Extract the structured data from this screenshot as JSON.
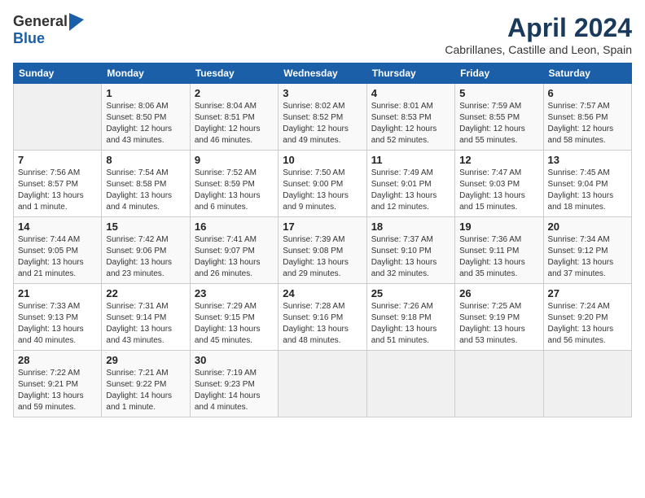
{
  "header": {
    "logo_general": "General",
    "logo_blue": "Blue",
    "month_year": "April 2024",
    "location": "Cabrillanes, Castille and Leon, Spain"
  },
  "calendar": {
    "days_of_week": [
      "Sunday",
      "Monday",
      "Tuesday",
      "Wednesday",
      "Thursday",
      "Friday",
      "Saturday"
    ],
    "weeks": [
      [
        {
          "day": "",
          "info": ""
        },
        {
          "day": "1",
          "info": "Sunrise: 8:06 AM\nSunset: 8:50 PM\nDaylight: 12 hours\nand 43 minutes."
        },
        {
          "day": "2",
          "info": "Sunrise: 8:04 AM\nSunset: 8:51 PM\nDaylight: 12 hours\nand 46 minutes."
        },
        {
          "day": "3",
          "info": "Sunrise: 8:02 AM\nSunset: 8:52 PM\nDaylight: 12 hours\nand 49 minutes."
        },
        {
          "day": "4",
          "info": "Sunrise: 8:01 AM\nSunset: 8:53 PM\nDaylight: 12 hours\nand 52 minutes."
        },
        {
          "day": "5",
          "info": "Sunrise: 7:59 AM\nSunset: 8:55 PM\nDaylight: 12 hours\nand 55 minutes."
        },
        {
          "day": "6",
          "info": "Sunrise: 7:57 AM\nSunset: 8:56 PM\nDaylight: 12 hours\nand 58 minutes."
        }
      ],
      [
        {
          "day": "7",
          "info": "Sunrise: 7:56 AM\nSunset: 8:57 PM\nDaylight: 13 hours\nand 1 minute."
        },
        {
          "day": "8",
          "info": "Sunrise: 7:54 AM\nSunset: 8:58 PM\nDaylight: 13 hours\nand 4 minutes."
        },
        {
          "day": "9",
          "info": "Sunrise: 7:52 AM\nSunset: 8:59 PM\nDaylight: 13 hours\nand 6 minutes."
        },
        {
          "day": "10",
          "info": "Sunrise: 7:50 AM\nSunset: 9:00 PM\nDaylight: 13 hours\nand 9 minutes."
        },
        {
          "day": "11",
          "info": "Sunrise: 7:49 AM\nSunset: 9:01 PM\nDaylight: 13 hours\nand 12 minutes."
        },
        {
          "day": "12",
          "info": "Sunrise: 7:47 AM\nSunset: 9:03 PM\nDaylight: 13 hours\nand 15 minutes."
        },
        {
          "day": "13",
          "info": "Sunrise: 7:45 AM\nSunset: 9:04 PM\nDaylight: 13 hours\nand 18 minutes."
        }
      ],
      [
        {
          "day": "14",
          "info": "Sunrise: 7:44 AM\nSunset: 9:05 PM\nDaylight: 13 hours\nand 21 minutes."
        },
        {
          "day": "15",
          "info": "Sunrise: 7:42 AM\nSunset: 9:06 PM\nDaylight: 13 hours\nand 23 minutes."
        },
        {
          "day": "16",
          "info": "Sunrise: 7:41 AM\nSunset: 9:07 PM\nDaylight: 13 hours\nand 26 minutes."
        },
        {
          "day": "17",
          "info": "Sunrise: 7:39 AM\nSunset: 9:08 PM\nDaylight: 13 hours\nand 29 minutes."
        },
        {
          "day": "18",
          "info": "Sunrise: 7:37 AM\nSunset: 9:10 PM\nDaylight: 13 hours\nand 32 minutes."
        },
        {
          "day": "19",
          "info": "Sunrise: 7:36 AM\nSunset: 9:11 PM\nDaylight: 13 hours\nand 35 minutes."
        },
        {
          "day": "20",
          "info": "Sunrise: 7:34 AM\nSunset: 9:12 PM\nDaylight: 13 hours\nand 37 minutes."
        }
      ],
      [
        {
          "day": "21",
          "info": "Sunrise: 7:33 AM\nSunset: 9:13 PM\nDaylight: 13 hours\nand 40 minutes."
        },
        {
          "day": "22",
          "info": "Sunrise: 7:31 AM\nSunset: 9:14 PM\nDaylight: 13 hours\nand 43 minutes."
        },
        {
          "day": "23",
          "info": "Sunrise: 7:29 AM\nSunset: 9:15 PM\nDaylight: 13 hours\nand 45 minutes."
        },
        {
          "day": "24",
          "info": "Sunrise: 7:28 AM\nSunset: 9:16 PM\nDaylight: 13 hours\nand 48 minutes."
        },
        {
          "day": "25",
          "info": "Sunrise: 7:26 AM\nSunset: 9:18 PM\nDaylight: 13 hours\nand 51 minutes."
        },
        {
          "day": "26",
          "info": "Sunrise: 7:25 AM\nSunset: 9:19 PM\nDaylight: 13 hours\nand 53 minutes."
        },
        {
          "day": "27",
          "info": "Sunrise: 7:24 AM\nSunset: 9:20 PM\nDaylight: 13 hours\nand 56 minutes."
        }
      ],
      [
        {
          "day": "28",
          "info": "Sunrise: 7:22 AM\nSunset: 9:21 PM\nDaylight: 13 hours\nand 59 minutes."
        },
        {
          "day": "29",
          "info": "Sunrise: 7:21 AM\nSunset: 9:22 PM\nDaylight: 14 hours\nand 1 minute."
        },
        {
          "day": "30",
          "info": "Sunrise: 7:19 AM\nSunset: 9:23 PM\nDaylight: 14 hours\nand 4 minutes."
        },
        {
          "day": "",
          "info": ""
        },
        {
          "day": "",
          "info": ""
        },
        {
          "day": "",
          "info": ""
        },
        {
          "day": "",
          "info": ""
        }
      ]
    ]
  }
}
